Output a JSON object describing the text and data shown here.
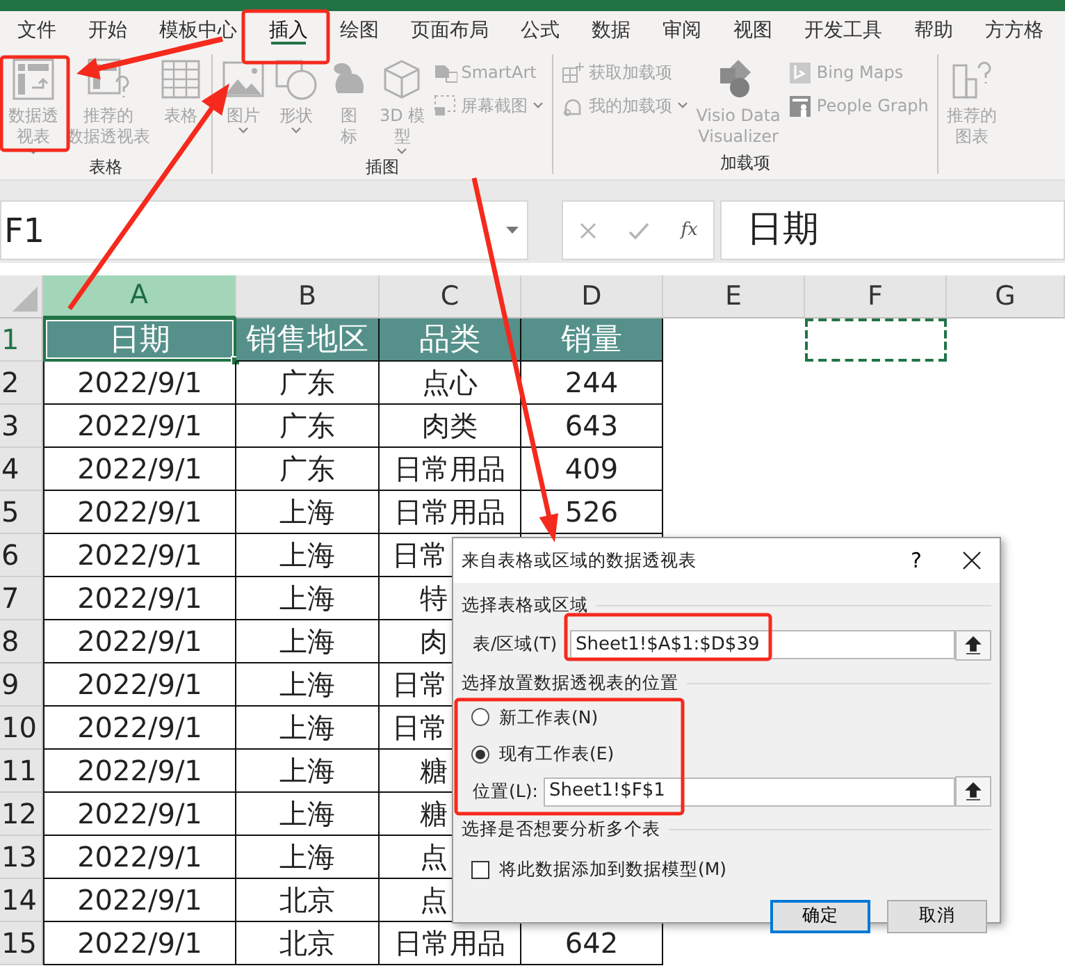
{
  "tabs": [
    {
      "label": "文件",
      "selected": false
    },
    {
      "label": "开始",
      "selected": false
    },
    {
      "label": "模板中心",
      "selected": false
    },
    {
      "label": "插入",
      "selected": true
    },
    {
      "label": "绘图",
      "selected": false
    },
    {
      "label": "页面布局",
      "selected": false
    },
    {
      "label": "公式",
      "selected": false
    },
    {
      "label": "数据",
      "selected": false
    },
    {
      "label": "审阅",
      "selected": false
    },
    {
      "label": "视图",
      "selected": false
    },
    {
      "label": "开发工具",
      "selected": false
    },
    {
      "label": "帮助",
      "selected": false
    },
    {
      "label": "方方格",
      "selected": false
    }
  ],
  "ribbon_groups": [
    {
      "label": "表格",
      "items": [
        {
          "kind": "large",
          "lines": [
            "数据透",
            "视表"
          ],
          "dropdown": true,
          "disabled": true
        },
        {
          "kind": "large",
          "lines": [
            "推荐的",
            "数据透视表"
          ],
          "dropdown": false,
          "disabled": true
        },
        {
          "kind": "large",
          "lines": [
            "表格"
          ],
          "dropdown": false,
          "disabled": true
        }
      ]
    },
    {
      "label": "插图",
      "items": [
        {
          "kind": "large",
          "lines": [
            "图片"
          ],
          "dropdown": true,
          "disabled": true
        },
        {
          "kind": "large",
          "lines": [
            "形状"
          ],
          "dropdown": true,
          "disabled": true
        },
        {
          "kind": "large",
          "lines": [
            "图",
            "标"
          ],
          "dropdown": false,
          "disabled": true
        },
        {
          "kind": "large",
          "lines": [
            "3D 模",
            "型"
          ],
          "dropdown": true,
          "disabled": true
        },
        {
          "kind": "stack",
          "buttons": [
            {
              "label": "SmartArt",
              "dropdown": false,
              "disabled": true
            },
            {
              "label": "屏幕截图",
              "dropdown": true,
              "disabled": true
            }
          ]
        }
      ]
    },
    {
      "label": "加载项",
      "items": [
        {
          "kind": "stack",
          "buttons": [
            {
              "label": "获取加载项",
              "dropdown": false,
              "disabled": true
            },
            {
              "label": "我的加载项",
              "dropdown": true,
              "disabled": true
            }
          ]
        },
        {
          "kind": "large",
          "lines": [
            "Visio Data",
            "Visualizer"
          ],
          "dropdown": false,
          "disabled": true
        },
        {
          "kind": "stack",
          "buttons": [
            {
              "label": "Bing Maps",
              "dropdown": false,
              "disabled": true
            },
            {
              "label": "People Graph",
              "dropdown": false,
              "disabled": true
            }
          ]
        }
      ]
    },
    {
      "items": [
        {
          "kind": "large",
          "lines": [
            "推荐的",
            "图表"
          ],
          "dropdown": false,
          "disabled": true
        }
      ]
    }
  ],
  "formula_bar": {
    "name_box": "F1",
    "function_button": "fx",
    "content": "日期"
  },
  "sheet": {
    "columns": [
      {
        "label": "A",
        "selected": true,
        "marquee": false
      },
      {
        "label": "B",
        "selected": false,
        "marquee": false
      },
      {
        "label": "C",
        "selected": false,
        "marquee": false
      },
      {
        "label": "D",
        "selected": false,
        "marquee": false
      },
      {
        "label": "E",
        "selected": false,
        "marquee": false
      },
      {
        "label": "F",
        "selected": false,
        "marquee": true
      },
      {
        "label": "G",
        "selected": false,
        "marquee": false
      }
    ],
    "header_row": {
      "label": "1",
      "selected": true,
      "cells": [
        "日期",
        "销售地区",
        "品类",
        "销量"
      ]
    },
    "rows": [
      {
        "label": "2",
        "selected": false,
        "cells": [
          "2022/9/1",
          "广东",
          "点心",
          "244"
        ]
      },
      {
        "label": "3",
        "selected": false,
        "cells": [
          "2022/9/1",
          "广东",
          "肉类",
          "643"
        ]
      },
      {
        "label": "4",
        "selected": false,
        "cells": [
          "2022/9/1",
          "广东",
          "日常用品",
          "409"
        ]
      },
      {
        "label": "5",
        "selected": false,
        "cells": [
          "2022/9/1",
          "上海",
          "日常用品",
          "526"
        ]
      },
      {
        "label": "6",
        "selected": false,
        "cells": [
          "2022/9/1",
          "上海",
          "日常"
        ]
      },
      {
        "label": "7",
        "selected": false,
        "cells": [
          "2022/9/1",
          "上海",
          "特"
        ]
      },
      {
        "label": "8",
        "selected": false,
        "cells": [
          "2022/9/1",
          "上海",
          "肉"
        ]
      },
      {
        "label": "9",
        "selected": false,
        "cells": [
          "2022/9/1",
          "上海",
          "日常"
        ]
      },
      {
        "label": "10",
        "selected": false,
        "cells": [
          "2022/9/1",
          "上海",
          "日常"
        ]
      },
      {
        "label": "11",
        "selected": false,
        "cells": [
          "2022/9/1",
          "上海",
          "糖"
        ]
      },
      {
        "label": "12",
        "selected": false,
        "cells": [
          "2022/9/1",
          "上海",
          "糖"
        ]
      },
      {
        "label": "13",
        "selected": false,
        "cells": [
          "2022/9/1",
          "上海",
          "点"
        ]
      },
      {
        "label": "14",
        "selected": false,
        "cells": [
          "2022/9/1",
          "北京",
          "点"
        ]
      },
      {
        "label": "15",
        "selected": false,
        "cells": [
          "2022/9/1",
          "北京",
          "日常用品",
          "642"
        ]
      }
    ]
  },
  "dialog": {
    "title": "来自表格或区域的数据透视表",
    "help": "?",
    "sections": [
      {
        "kind": "field",
        "heading": "选择表格或区域",
        "label": "表/区域(T)",
        "value": "Sheet1!$A$1:$D$39"
      },
      {
        "kind": "placement",
        "heading": "选择放置数据透视表的位置",
        "options": [
          {
            "label": "新工作表(N)",
            "selected": false
          },
          {
            "label": "现有工作表(E)",
            "selected": true
          }
        ],
        "label": "位置(L):",
        "value": "Sheet1!$F$1"
      },
      {
        "kind": "checkbox",
        "heading": "选择是否想要分析多个表",
        "label": "将此数据添加到数据模型(M)",
        "checked": false
      }
    ],
    "buttons": [
      {
        "label": "确定",
        "default": true
      },
      {
        "label": "取消",
        "default": false
      }
    ]
  }
}
